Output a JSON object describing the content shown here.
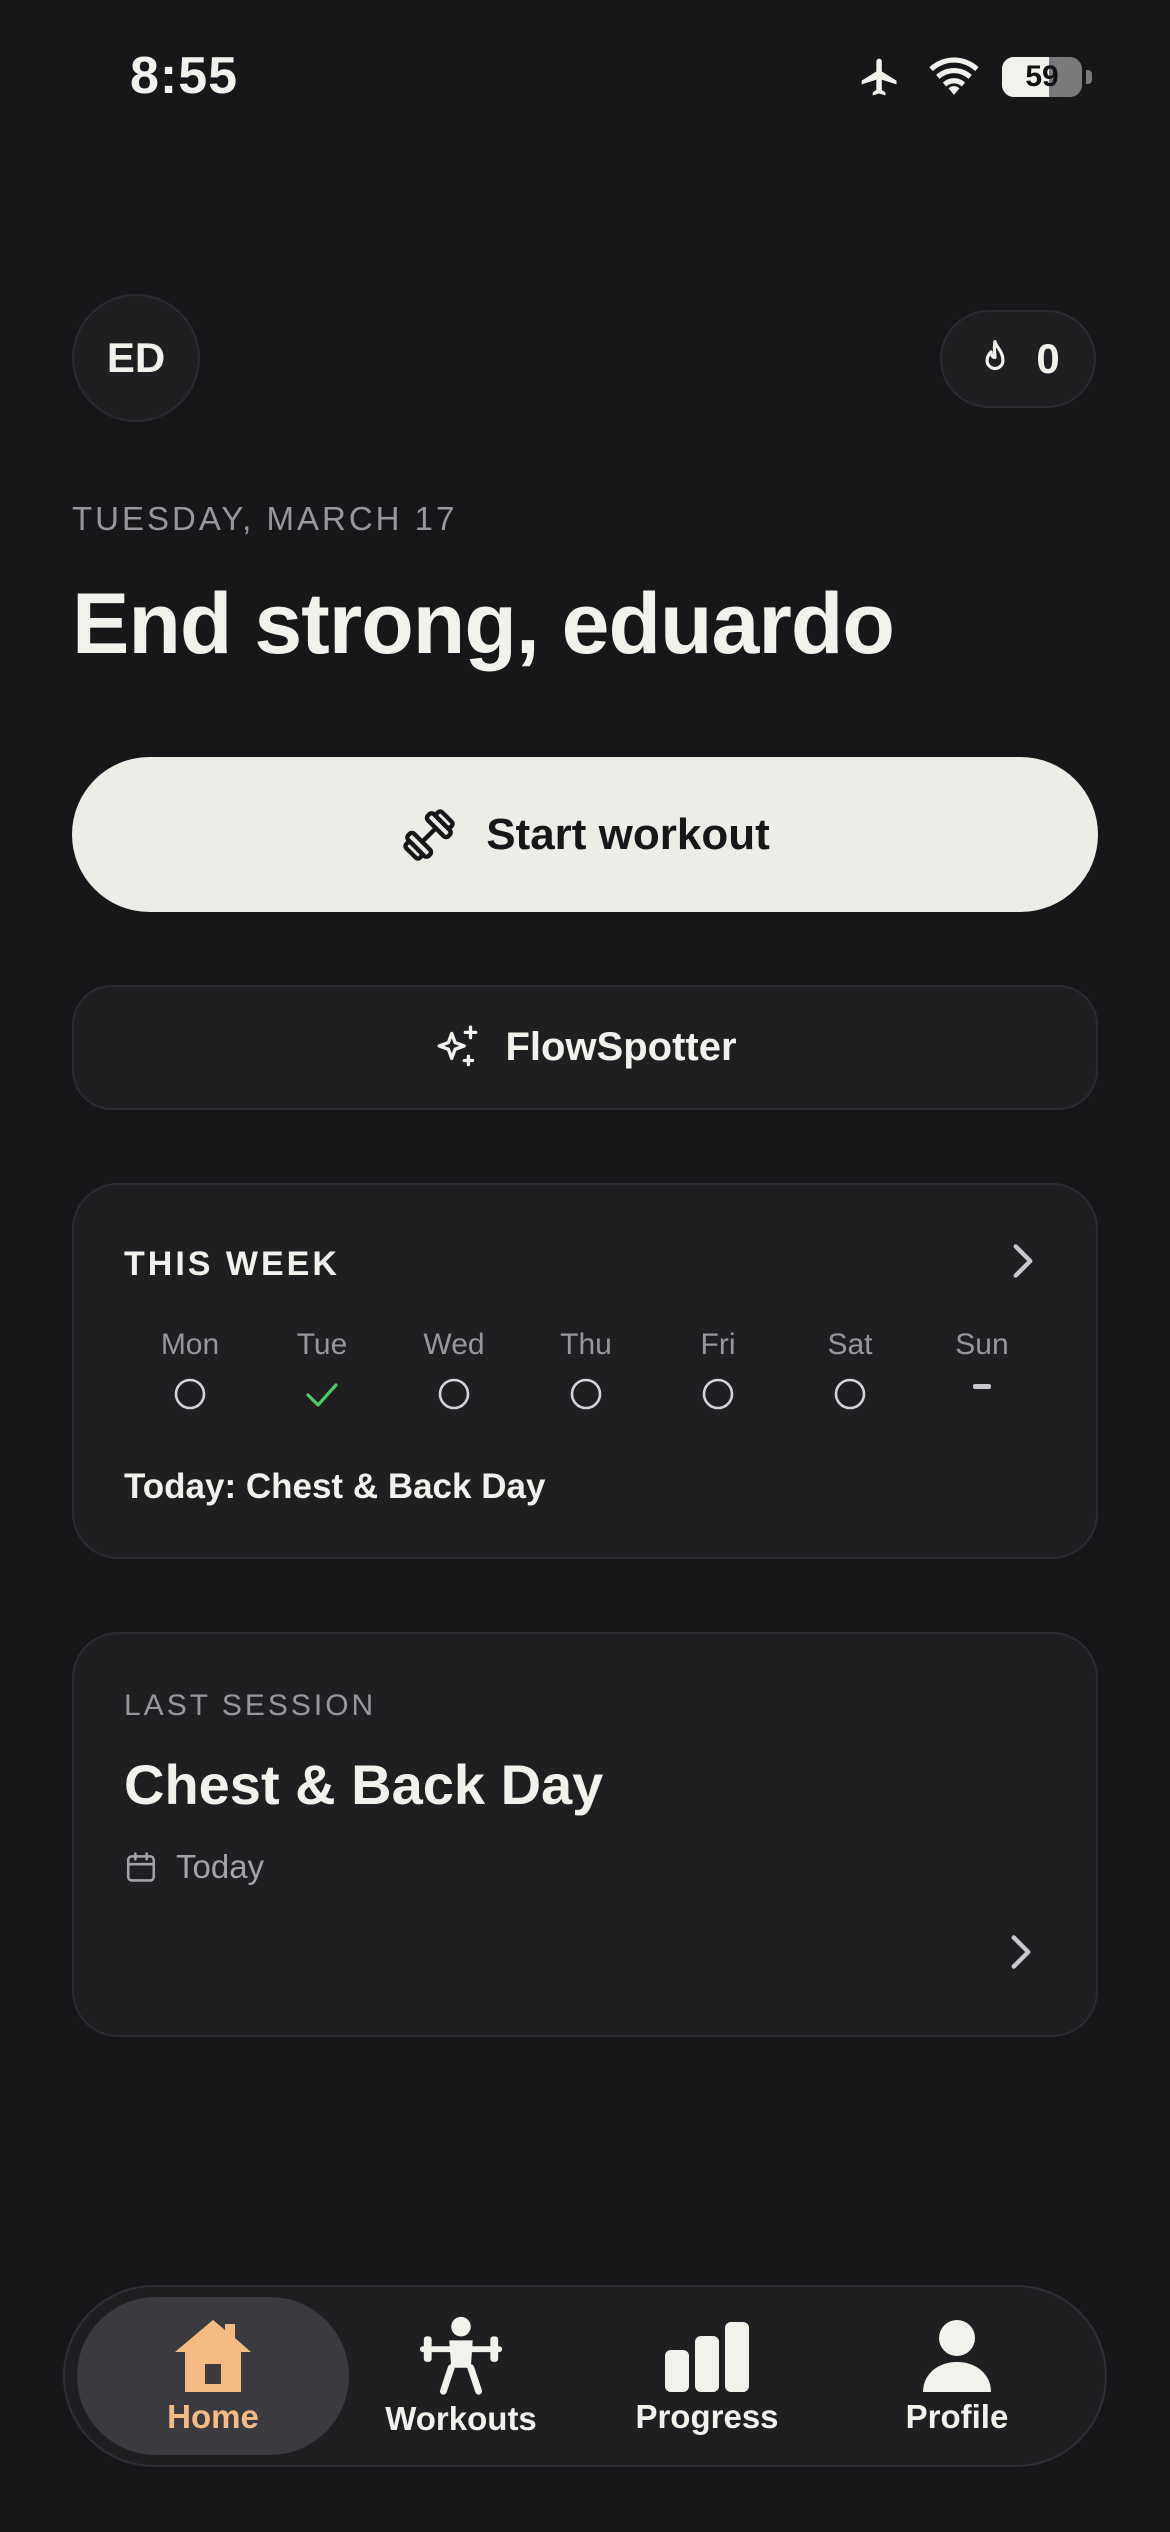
{
  "status_bar": {
    "time": "8:55",
    "battery": "59"
  },
  "header": {
    "avatar_initials": "ED",
    "streak_count": "0"
  },
  "date_line": "TUESDAY, MARCH 17",
  "greeting": "End strong, eduardo",
  "start_workout_label": "Start workout",
  "flowspotter_label": "FlowSpotter",
  "this_week": {
    "title": "THIS WEEK",
    "days": [
      {
        "label": "Mon",
        "status": "pending"
      },
      {
        "label": "Tue",
        "status": "done"
      },
      {
        "label": "Wed",
        "status": "pending"
      },
      {
        "label": "Thu",
        "status": "pending"
      },
      {
        "label": "Fri",
        "status": "pending"
      },
      {
        "label": "Sat",
        "status": "pending"
      },
      {
        "label": "Sun",
        "status": "rest"
      }
    ],
    "today_text": "Today: Chest & Back Day"
  },
  "last_session": {
    "label": "LAST SESSION",
    "title": "Chest & Back Day",
    "date": "Today"
  },
  "tabs": [
    {
      "label": "Home",
      "active": true
    },
    {
      "label": "Workouts",
      "active": false
    },
    {
      "label": "Progress",
      "active": false
    },
    {
      "label": "Profile",
      "active": false
    }
  ],
  "colors": {
    "background": "#17171a",
    "card": "#1f1f22",
    "accent": "#f6bb82",
    "check": "#4cc96a",
    "primary_button": "#edece6"
  }
}
